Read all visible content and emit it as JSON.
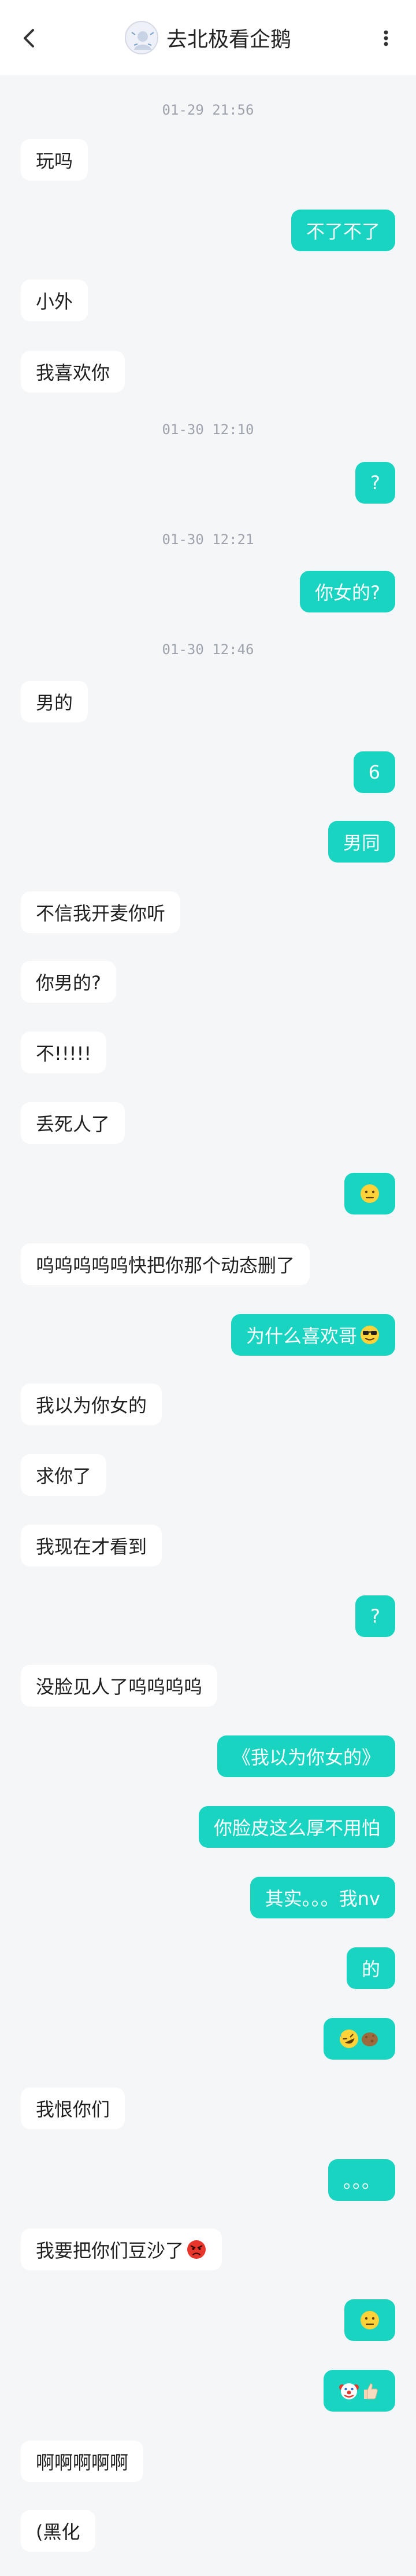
{
  "header": {
    "title": "去北极看企鹅",
    "back_icon": "chevron-left-icon",
    "more_icon": "more-vertical-icon"
  },
  "colors": {
    "sent_bubble": "#19d4c0",
    "received_bubble": "#ffffff",
    "background": "#f5f6f8",
    "timestamp": "#9ea3ad"
  },
  "messages": [
    {
      "type": "time",
      "text": "01-29 21:56"
    },
    {
      "type": "recv",
      "text": "玩吗"
    },
    {
      "type": "sent",
      "text": "不了不了"
    },
    {
      "type": "recv",
      "text": "小外"
    },
    {
      "type": "recv",
      "text": "我喜欢你"
    },
    {
      "type": "time",
      "text": "01-30 12:10"
    },
    {
      "type": "sent",
      "text": "?"
    },
    {
      "type": "time",
      "text": "01-30 12:21"
    },
    {
      "type": "sent",
      "text": "你女的?"
    },
    {
      "type": "time",
      "text": "01-30 12:46"
    },
    {
      "type": "recv",
      "text": "男的"
    },
    {
      "type": "sent",
      "text": "6"
    },
    {
      "type": "sent",
      "text": "男同"
    },
    {
      "type": "recv",
      "text": "不信我开麦你听"
    },
    {
      "type": "recv",
      "text": "你男的?"
    },
    {
      "type": "recv",
      "text": "不!!!!!"
    },
    {
      "type": "recv",
      "text": "丢死人了"
    },
    {
      "type": "sent",
      "text": "",
      "emoji": [
        "neutral-face-emoji"
      ]
    },
    {
      "type": "recv",
      "text": "呜呜呜呜呜快把你那个动态删了"
    },
    {
      "type": "sent",
      "text": "为什么喜欢哥",
      "emoji": [
        "sunglasses-face-emoji"
      ]
    },
    {
      "type": "recv",
      "text": "我以为你女的"
    },
    {
      "type": "recv",
      "text": "求你了"
    },
    {
      "type": "recv",
      "text": "我现在才看到"
    },
    {
      "type": "sent",
      "text": "?"
    },
    {
      "type": "recv",
      "text": "没脸见人了呜呜呜呜"
    },
    {
      "type": "sent",
      "text": "《我以为你女的》"
    },
    {
      "type": "sent",
      "text": "你脸皮这么厚不用怕"
    },
    {
      "type": "sent",
      "text": "其实。。。我nv"
    },
    {
      "type": "sent",
      "text": "的"
    },
    {
      "type": "sent",
      "text": "",
      "emoji": [
        "rolling-laughing-emoji",
        "brick-emoji"
      ]
    },
    {
      "type": "recv",
      "text": "我恨你们"
    },
    {
      "type": "sent",
      "text": "。。。"
    },
    {
      "type": "recv",
      "text": "我要把你们豆沙了",
      "emoji": [
        "angry-face-emoji"
      ]
    },
    {
      "type": "sent",
      "text": "",
      "emoji": [
        "neutral-face-emoji"
      ]
    },
    {
      "type": "sent",
      "text": "",
      "emoji": [
        "clown-face-emoji",
        "thumbs-up-emoji"
      ]
    },
    {
      "type": "recv",
      "text": "啊啊啊啊啊"
    },
    {
      "type": "recv",
      "text": "(黑化"
    }
  ]
}
